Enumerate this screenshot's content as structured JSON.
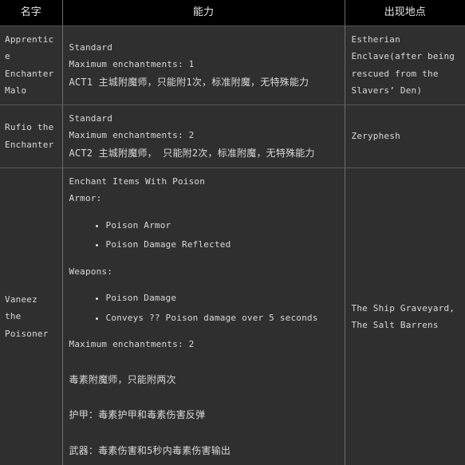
{
  "table": {
    "headers": [
      "名字",
      "能力",
      "出现地点"
    ],
    "rows": [
      {
        "name": "Apprentice Enchanter Malo",
        "ability": {
          "lines": [
            "Standard",
            "Maximum enchantments: 1",
            "ACT1 主城附魔师，只能附1次，标准附魔，无特殊能力"
          ]
        },
        "location": "Estherian Enclave(after being rescued from the Slavers’ Den)"
      },
      {
        "name": "Rufio the Enchanter",
        "ability": {
          "lines": [
            "Standard",
            "Maximum enchantments: 2",
            "ACT2 主城附魔师， 只能附2次，标准附魔，无特殊能力"
          ]
        },
        "location": "Zeryphesh"
      },
      {
        "name": "Vaneez the Poisoner",
        "ability": {
          "title": "Enchant Items With Poison",
          "armor_label": "Armor:",
          "armor_items": [
            "Poison Armor",
            "Poison Damage Reflected"
          ],
          "weapons_label": "Weapons:",
          "weapons_items": [
            "Poison Damage",
            "Conveys ?? Poison damage over 5 seconds"
          ],
          "max_enchantments": "Maximum enchantments: 2",
          "cjk_lines": [
            "毒素附魔师，只能附两次",
            "护甲：毒素护甲和毒素伤害反弹",
            "武器：毒素伤害和5秒内毒素伤害输出"
          ]
        },
        "location": "The Ship Graveyard, The Salt Barrens"
      }
    ]
  },
  "colors": {
    "page_background": "#2f2f2f",
    "header_background": "#000000",
    "text": "#d9d9d9",
    "border": "#6e6e6e"
  }
}
